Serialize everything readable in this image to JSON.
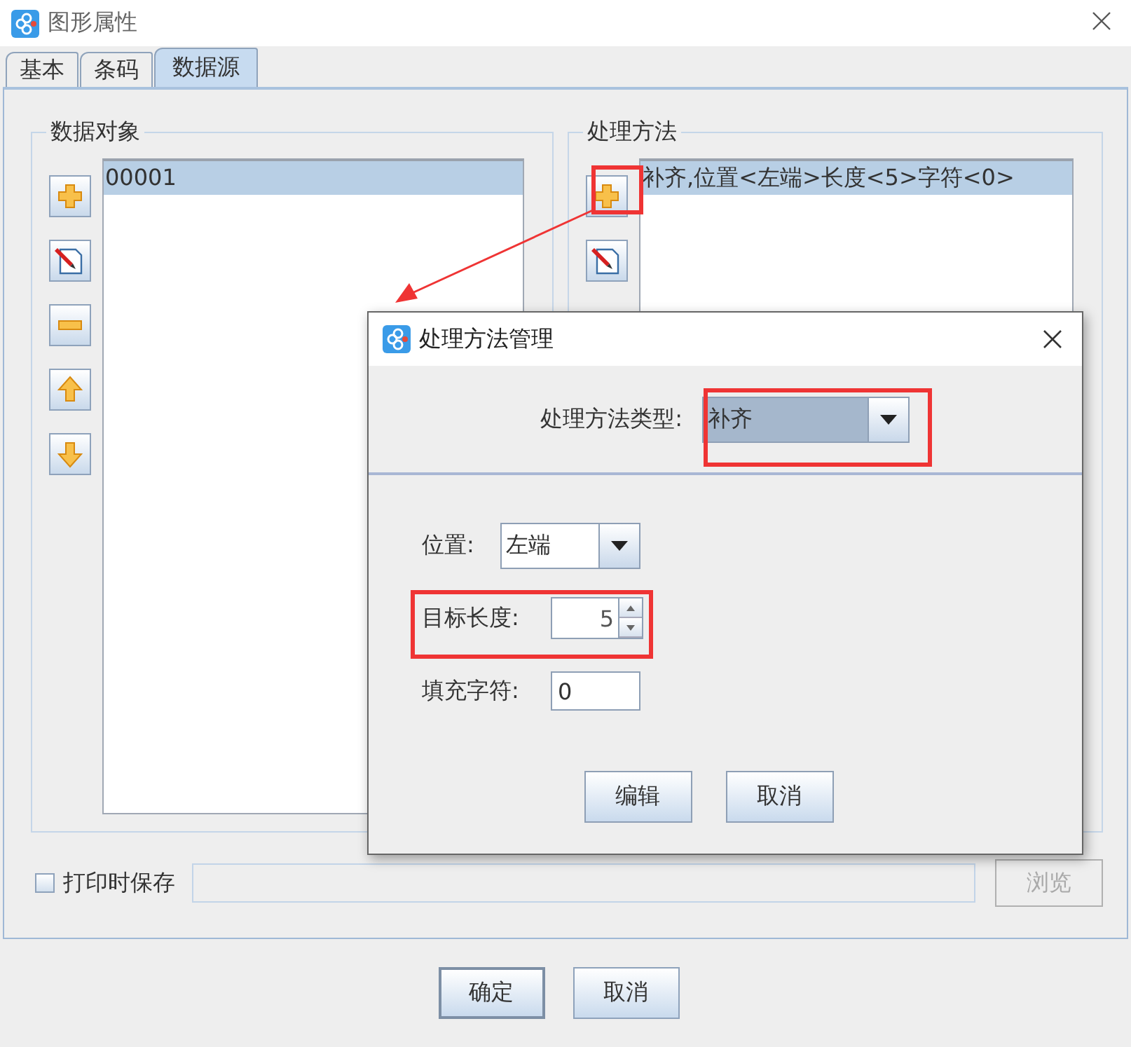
{
  "window": {
    "title": "图形属性"
  },
  "tabs": [
    {
      "label": "基本",
      "selected": false
    },
    {
      "label": "条码",
      "selected": false
    },
    {
      "label": "数据源",
      "selected": true
    }
  ],
  "data_objects": {
    "title": "数据对象",
    "items": [
      {
        "text": "00001",
        "selected": true
      }
    ]
  },
  "methods": {
    "title": "处理方法",
    "items": [
      {
        "text": "补齐,位置<左端>长度<5>字符<0>",
        "selected": true
      }
    ]
  },
  "save_on_print": {
    "label": "打印时保存",
    "checked": false
  },
  "browse_button": {
    "label": "浏览",
    "disabled": true
  },
  "buttons": [
    "确定",
    "取消"
  ],
  "dialog": {
    "title": "处理方法管理",
    "type_label": "处理方法类型:",
    "type_value": "补齐",
    "fields": [
      {
        "kind": "combo",
        "label": "位置:",
        "value": "左端"
      },
      {
        "kind": "spinner",
        "label": "目标长度:",
        "value": "5"
      },
      {
        "kind": "text",
        "label": "填充字符:",
        "value": "0"
      }
    ],
    "buttons": [
      "编辑",
      "取消"
    ]
  }
}
